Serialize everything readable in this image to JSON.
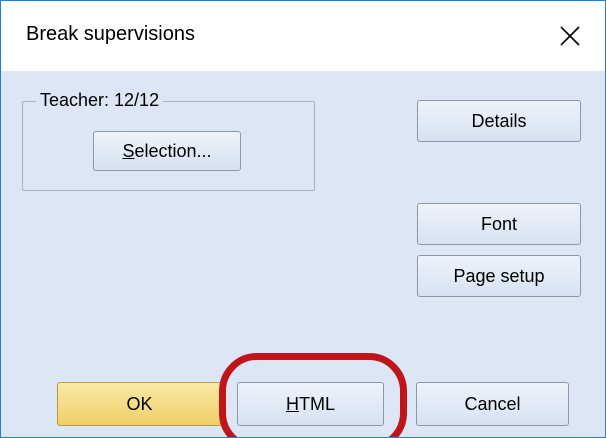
{
  "window": {
    "title": "Break supervisions",
    "close_icon": "close-icon"
  },
  "teacher_group": {
    "label": "Teacher: 12/12",
    "selection_button": {
      "mnemonic": "S",
      "rest": "election..."
    }
  },
  "buttons": {
    "details": "Details",
    "font": "Font",
    "page_setup": "Page setup",
    "ok": "OK",
    "html": {
      "mnemonic": "H",
      "rest": "TML"
    },
    "cancel": "Cancel"
  },
  "annotation": {
    "highlight_color": "#c0151b",
    "target": "html-button"
  },
  "colors": {
    "dialog_background": "#dce6f4",
    "window_border": "#1883d7",
    "ok_button": "#f1cf66"
  }
}
